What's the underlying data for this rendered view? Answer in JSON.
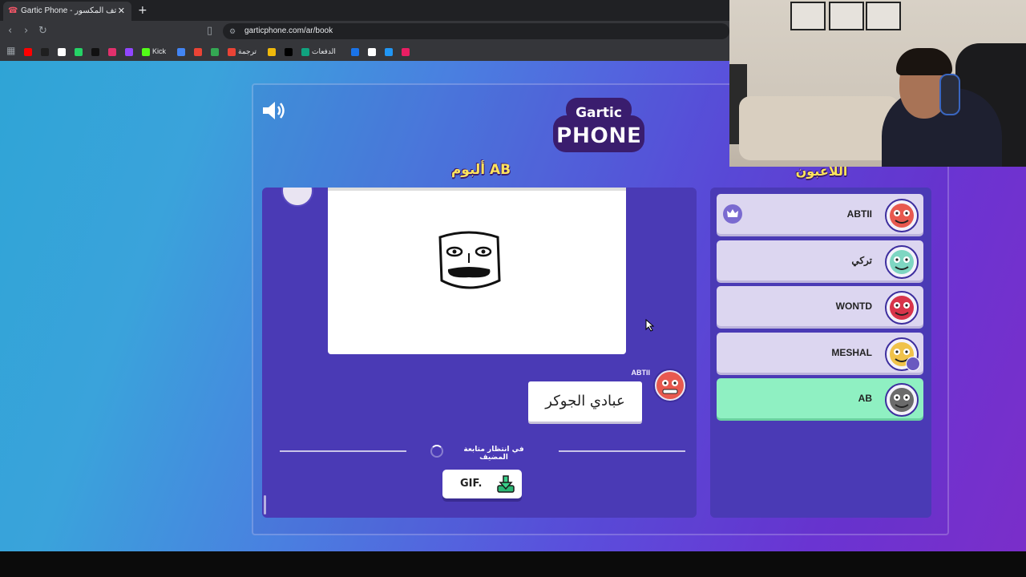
{
  "browser": {
    "tab_title": "Gartic Phone - لعبة الهاتف المكسور",
    "new_tab": "+",
    "close_tab": "✕",
    "url": "garticphone.com/ar/book",
    "bookmarks": [
      {
        "label": "",
        "color": "#ff0000"
      },
      {
        "label": "",
        "color": "#1f1f1f"
      },
      {
        "label": "",
        "color": "#ffffff"
      },
      {
        "label": "",
        "color": "#25d366"
      },
      {
        "label": "",
        "color": "#111111"
      },
      {
        "label": "",
        "color": "#e1306c"
      },
      {
        "label": "",
        "color": "#9146ff"
      },
      {
        "label": "Kick",
        "color": "#53fc18"
      },
      {
        "label": "",
        "color": "#4285f4"
      },
      {
        "label": "",
        "color": "#ea4335"
      },
      {
        "label": "",
        "color": "#34a853"
      },
      {
        "label": "ترجمة",
        "color": "#ea4335"
      },
      {
        "label": "",
        "color": "#f0b90b"
      },
      {
        "label": "",
        "color": "#000000"
      },
      {
        "label": "الدفعات",
        "color": "#10a37f"
      },
      {
        "label": "",
        "color": "#1a73e8"
      },
      {
        "label": "",
        "color": "#ffffff"
      },
      {
        "label": "",
        "color": "#2196f3"
      },
      {
        "label": "",
        "color": "#e91e63"
      }
    ]
  },
  "game": {
    "album_title": "ألبوم AB",
    "players_title": "اللاعبون",
    "author_name": "ABTII",
    "guess_text": "عبادي الجوكر",
    "waiting_text": "في انتظار متابعة المضيف",
    "gif_button": "GIF.",
    "logo_top": "Gartic",
    "logo_bottom": "PHONE",
    "players": [
      {
        "name": "ABTII",
        "host": true,
        "me": false,
        "avatar_color": "#e8594f"
      },
      {
        "name": "تركي",
        "host": false,
        "me": false,
        "avatar_color": "#7ed6c2"
      },
      {
        "name": "WONTD",
        "host": false,
        "me": false,
        "avatar_color": "#d8344a"
      },
      {
        "name": "MESHAL",
        "host": false,
        "me": false,
        "avatar_color": "#f0c24a",
        "badge": true
      },
      {
        "name": "AB",
        "host": false,
        "me": true,
        "avatar_color": "#6b6b6b"
      }
    ]
  },
  "colors": {
    "accent_yellow": "#ffe45c",
    "panel_purple": "#4a3ab5",
    "me_green": "#8ff0c2"
  }
}
